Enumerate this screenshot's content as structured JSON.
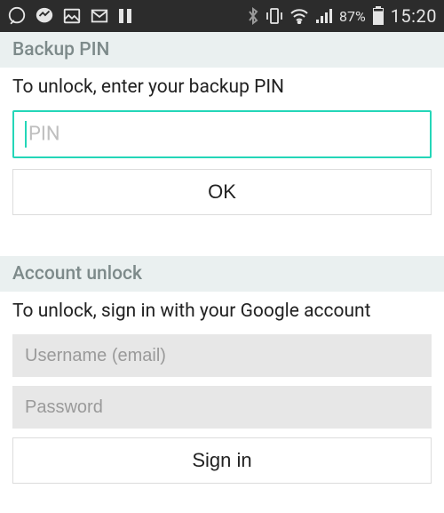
{
  "statusbar": {
    "battery_percent": "87%",
    "time": "15:20"
  },
  "backup_pin": {
    "header": "Backup PIN",
    "instruction": "To unlock, enter your backup PIN",
    "pin_placeholder": "PIN",
    "ok_label": "OK"
  },
  "account_unlock": {
    "header": "Account unlock",
    "instruction": "To unlock, sign in with your Google account",
    "username_placeholder": "Username (email)",
    "password_placeholder": "Password",
    "signin_label": "Sign in"
  }
}
